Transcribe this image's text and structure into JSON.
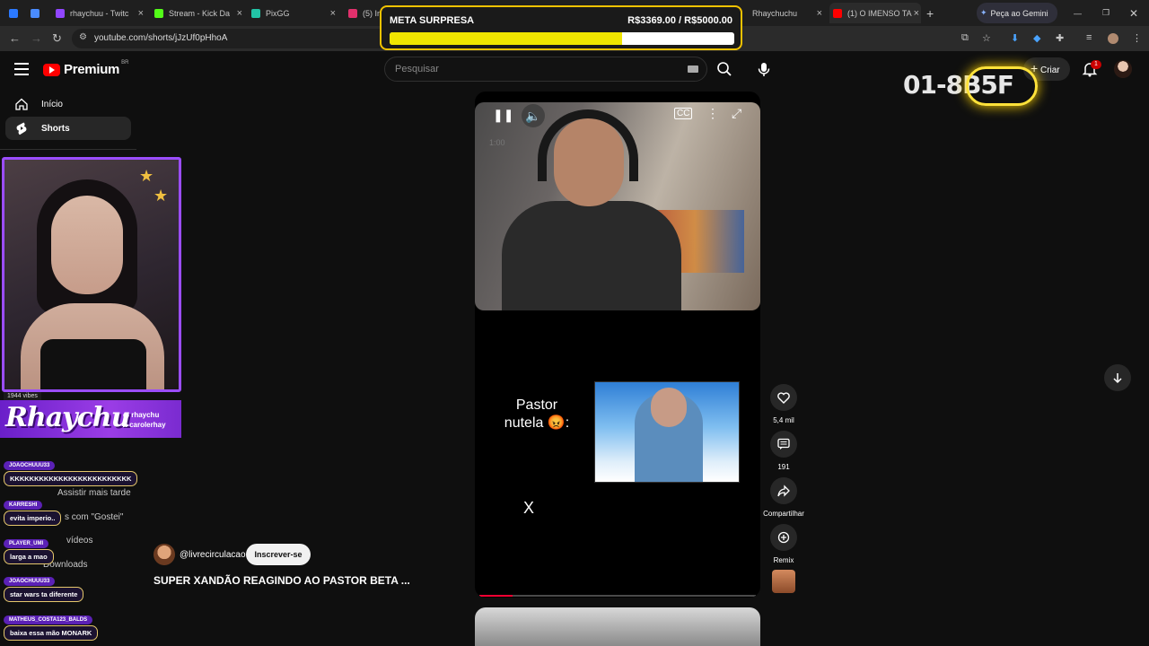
{
  "browser": {
    "tabs": [
      {
        "title": "rhaychuu - Twitc",
        "color": "#9146ff"
      },
      {
        "title": "Stream - Kick Da",
        "color": "#53fc18"
      },
      {
        "title": "PixGG",
        "color": "#22c4a6"
      },
      {
        "title": "(5) In",
        "color": "#e1306c"
      },
      {
        "title": "Rhaychuchu",
        "color": "#ff0000"
      },
      {
        "title": "(1) O IMENSO TA",
        "color": "#ff0000"
      }
    ],
    "new_tab": "+",
    "gemini": "Peça ao Gemini",
    "url": "youtube.com/shorts/jJzUf0pHhoA"
  },
  "header": {
    "logo": "Premium",
    "logo_region": "BR",
    "search_placeholder": "Pesquisar",
    "create_label": "Criar",
    "notification_count": "1"
  },
  "sidebar": {
    "home": "Início",
    "shorts": "Shorts",
    "ghost_items": [
      "Assistir mais tarde",
      "s com \"Gostei\"",
      "vídeos",
      "Downloads"
    ]
  },
  "overlay": {
    "meta_title": "META SURPRESA",
    "meta_amount": "R$3369.00 / R$5000.00",
    "meta_progress": 0.6738,
    "meta_color": "#f0e500",
    "vibes": "1944 vibes",
    "streamer": "Rhaychu",
    "handle_1": "rhaychu",
    "handle_2": "carolerhay",
    "chat": [
      {
        "user": "JOAOCHUUU33",
        "msg": "KKKKKKKKKKKKKKKKKKKKKKKKK"
      },
      {
        "user": "KARRESHI",
        "msg": "evita imperio.."
      },
      {
        "user": "PLAYER_UMI",
        "msg": "larga a mao"
      },
      {
        "user": "JOAOCHUUU33",
        "msg": "star wars ta diferente"
      },
      {
        "user": "MATHEUS_COSTA123_BALDS",
        "msg": "baixa essa mão MONARK"
      }
    ]
  },
  "short": {
    "time": "1:00",
    "caption": "Pastor nutela 😡:",
    "x_mark": "X",
    "progress": 0.12,
    "channel": "@livrecirculacao",
    "subscribe": "Inscrever-se",
    "title": "SUPER XANDÃO REAGINDO AO PASTOR BETA ..."
  },
  "actions": {
    "likes": "5,4 mil",
    "comments": "191",
    "share": "Compartilhar",
    "remix": "Remix"
  },
  "neon_sign": "01-8B5F"
}
